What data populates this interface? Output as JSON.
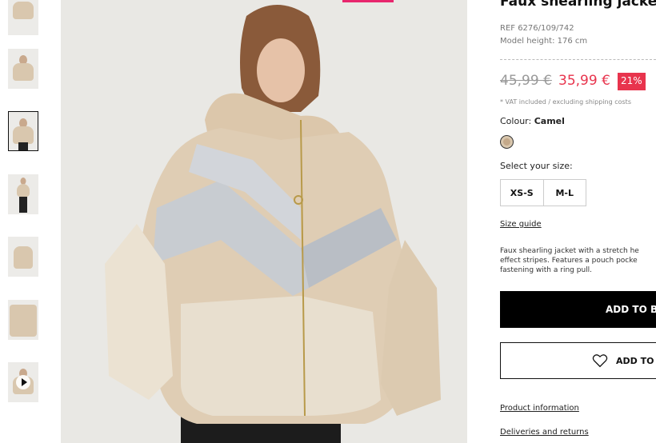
{
  "product": {
    "title": "Faux shearling jacket wi",
    "ref": "REF 6276/109/742",
    "model_height": "Model height: 176 cm",
    "old_price": "45,99 €",
    "new_price": "35,99 €",
    "discount": "21%",
    "vat_note": "* VAT included / excluding shipping costs",
    "colour_label": "Colour:",
    "colour_value": "Camel",
    "size_label": "Select your size:",
    "sizes": [
      "XS-S",
      "M-L"
    ],
    "size_guide": "Size guide",
    "description": "Faux shearling jacket with a stretch he effect stripes. Features a pouch pocke fastening with a ring pull."
  },
  "actions": {
    "add_to_bag": "ADD TO BA",
    "add_to_wishlist": "ADD TO W"
  },
  "links": {
    "product_information": "Product information",
    "deliveries": "Deliveries and returns"
  },
  "colors": {
    "accent": "#e8344d",
    "top_indicator": "#e8266d",
    "button_bg": "#000000"
  },
  "icons": {
    "wishlist": "heart-icon",
    "video": "play-icon"
  }
}
